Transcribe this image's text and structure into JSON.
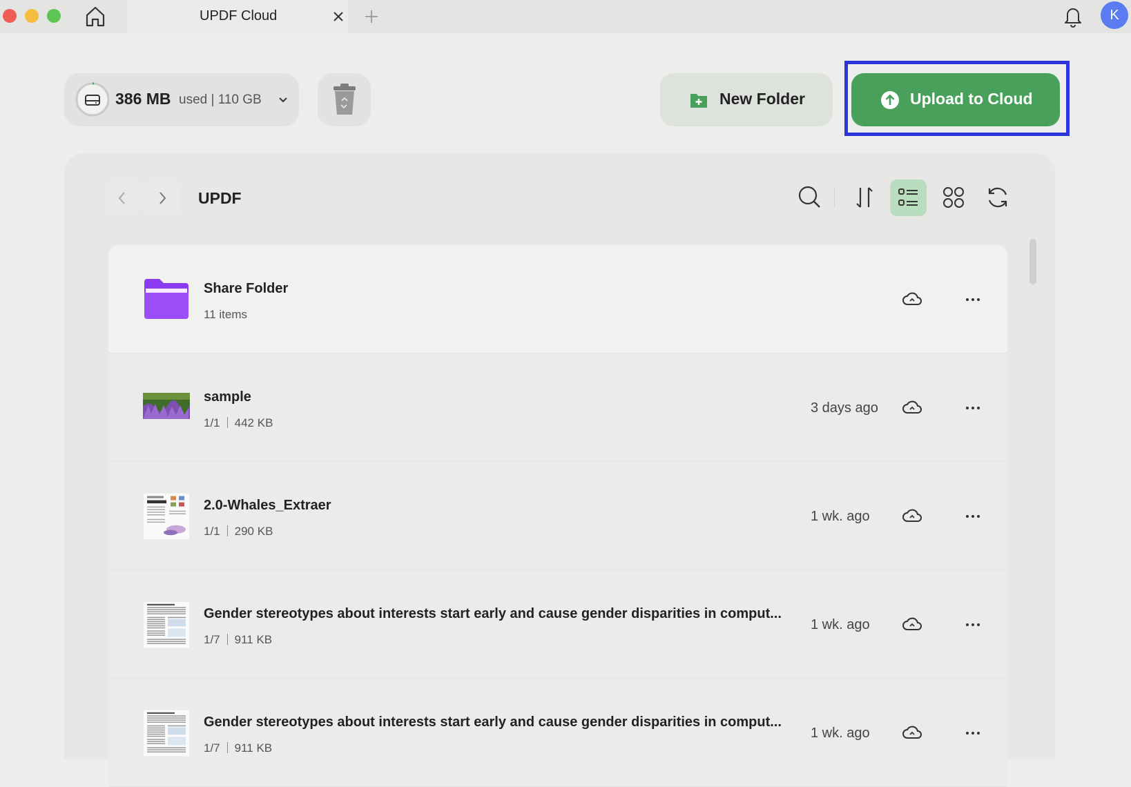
{
  "window": {
    "tab_title": "UPDF Cloud",
    "avatar_letter": "K"
  },
  "storage": {
    "used_value": "386 MB",
    "rest_text": "used | 110 GB"
  },
  "actions": {
    "new_folder_label": "New Folder",
    "upload_label": "Upload to Cloud"
  },
  "browser": {
    "folder_title": "UPDF",
    "view_mode": "list"
  },
  "files": [
    {
      "name": "Share Folder",
      "meta": "11 items",
      "pages": "",
      "size": "",
      "date": "",
      "thumb": "folder-icon"
    },
    {
      "name": "sample",
      "meta": "",
      "pages": "1/1",
      "size": "442 KB",
      "date": "3 days ago",
      "thumb": "photo-thumbnail"
    },
    {
      "name": "2.0-Whales_Extraer",
      "meta": "",
      "pages": "1/1",
      "size": "290 KB",
      "date": "1 wk. ago",
      "thumb": "document-thumbnail"
    },
    {
      "name": "Gender stereotypes about interests start early and cause gender disparities in comput...",
      "meta": "",
      "pages": "1/7",
      "size": "911 KB",
      "date": "1 wk. ago",
      "thumb": "document-thumbnail"
    },
    {
      "name": "Gender stereotypes about interests start early and cause gender disparities in comput...",
      "meta": "",
      "pages": "1/7",
      "size": "911 KB",
      "date": "1 wk. ago",
      "thumb": "document-thumbnail"
    }
  ],
  "colors": {
    "accent_green": "#48a05a",
    "highlight_border": "#2d34d8",
    "folder_purple": "#8b3cf0"
  }
}
